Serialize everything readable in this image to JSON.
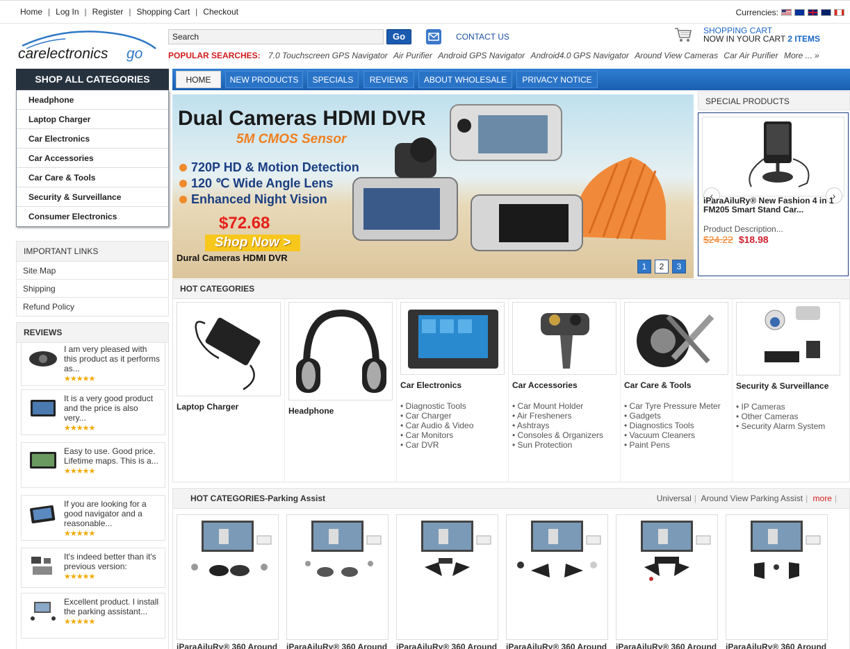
{
  "top_links": [
    "Home",
    "Log In",
    "Register",
    "Shopping Cart",
    "Checkout"
  ],
  "currencies_label": "Currencies:",
  "search": {
    "placeholder": "Search",
    "value": "Search",
    "button": "Go"
  },
  "contact_label": "CONTACT US",
  "cart": {
    "title": "SHOPPING CART",
    "status_prefix": "NOW IN YOUR CART",
    "count": "2 ITEMS"
  },
  "popular": {
    "label": "POPULAR SEARCHES:",
    "items": [
      "7.0 Touchscreen GPS Navigator",
      "Air Purifier",
      "Android GPS Navigator",
      "Android4.0 GPS Navigator",
      "Around View Cameras",
      "Car Air Purifier",
      "More ... »"
    ]
  },
  "sidebar": {
    "categories_title": "SHOP ALL CATEGORIES",
    "categories": [
      "Headphone",
      "Laptop Charger",
      "Car Electronics",
      "Car Accessories",
      "Car Care & Tools",
      "Security & Surveillance",
      "Consumer Electronics"
    ],
    "important_title": "IMPORTANT LINKS",
    "important": [
      "Site Map",
      "Shipping",
      "Refund Policy"
    ],
    "reviews_title": "REVIEWS",
    "reviews": [
      {
        "text": "I am very pleased with this product as it performs as...",
        "stars": "★★★★★"
      },
      {
        "text": "It is a very good product and the price is also very...",
        "stars": "★★★★★"
      },
      {
        "text": "Easy to use. Good price. Lifetime maps. This is a...",
        "stars": "★★★★★"
      },
      {
        "text": "If you are looking for a good navigator and a reasonable...",
        "stars": "★★★★★"
      },
      {
        "text": "It's indeed better than it's previous version:",
        "stars": "★★★★★"
      },
      {
        "text": "Excellent product. I install the parking assistant...",
        "stars": "★★★★★"
      }
    ]
  },
  "nav": [
    "HOME",
    "NEW PRODUCTS",
    "SPECIALS",
    "REVIEWS",
    "ABOUT WHOLESALE",
    "PRIVACY NOTICE"
  ],
  "banner": {
    "title": "Dual Cameras HDMI DVR",
    "subtitle": "5M CMOS Sensor",
    "features": [
      "720P HD & Motion Detection",
      "120 ℃ Wide Angle Lens",
      "Enhanced Night Vision"
    ],
    "price": "$72.68",
    "cta": "Shop Now >",
    "caption": "Dural Cameras HDMI DVR",
    "pages": [
      "1",
      "2",
      "3"
    ],
    "active_page": 2
  },
  "special": {
    "title": "SPECIAL PRODUCTS",
    "name": "iParaAiluRy® New Fashion 4 in 1 FM205 Smart Stand Car...",
    "desc": "Product Description...",
    "old_price": "$24.22",
    "new_price": "$18.98"
  },
  "hot": {
    "title": "HOT CATEGORIES",
    "items": [
      {
        "name": "Laptop Charger",
        "subs": []
      },
      {
        "name": "Headphone",
        "subs": []
      },
      {
        "name": "Car Electronics",
        "subs": [
          "• Diagnostic Tools",
          "• Car Charger",
          "• Car Audio & Video",
          "• Car Monitors",
          "• Car DVR"
        ]
      },
      {
        "name": "Car Accessories",
        "subs": [
          "• Car Mount Holder",
          "• Air Fresheners",
          "• Ashtrays",
          "• Consoles & Organizers",
          "• Sun Protection"
        ]
      },
      {
        "name": "Car Care & Tools",
        "subs": [
          "• Car Tyre Pressure Meter",
          "• Gadgets",
          "• Diagnostics Tools",
          "• Vacuum Cleaners",
          "• Paint Pens"
        ]
      },
      {
        "name": "Security & Surveillance",
        "subs": [
          "• IP Cameras",
          "• Other Cameras",
          "• Security Alarm System"
        ]
      }
    ]
  },
  "parking": {
    "title": "HOT CATEGORIES-Parking Assist",
    "links": [
      "Universal",
      "Around View Parking Assist"
    ],
    "more": "more",
    "products": [
      "iParaAiluRy® 360 Around",
      "iParaAiluRy® 360 Around",
      "iParaAiluRy® 360 Around",
      "iParaAiluRy® 360 Around",
      "iParaAiluRy® 360 Around",
      "iParaAiluRy® 360 Around"
    ]
  },
  "colors": {
    "brand_blue": "#1b5fb0",
    "accent_red": "#d01c1c",
    "dark_header": "#27323f",
    "star": "#f2a900"
  }
}
